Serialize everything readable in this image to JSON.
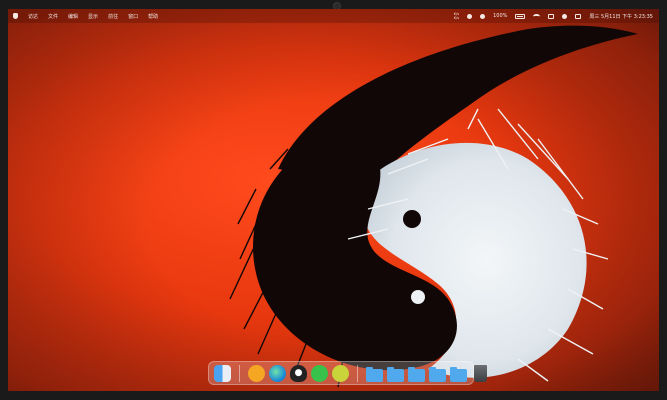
{
  "menubar": {
    "apple_icon": "apple-icon",
    "menus": [
      "访达",
      "文件",
      "编辑",
      "显示",
      "前往",
      "窗口",
      "帮助"
    ],
    "status_text_top": "K/s",
    "status_text_bottom": "K/s",
    "battery_percent": "100%",
    "datetime": "周三 5月11日 下午 3:23:35"
  },
  "dock": {
    "apps": [
      {
        "name": "finder-icon",
        "color": "#3d8eea"
      },
      {
        "name": "app-shield-icon",
        "color": "#f5a623"
      },
      {
        "name": "edge-icon",
        "color": "#1f8fd6"
      },
      {
        "name": "qq-icon",
        "color": "#222222"
      },
      {
        "name": "wechat-icon",
        "color": "#38c24b"
      },
      {
        "name": "app-green-icon",
        "color": "#c8d43a"
      }
    ],
    "folder_count": 5,
    "trash_icon": "trash-icon"
  },
  "colors": {
    "wallpaper_red": "#e8380f",
    "yin": "#120707",
    "yang": "#eaeff3"
  }
}
